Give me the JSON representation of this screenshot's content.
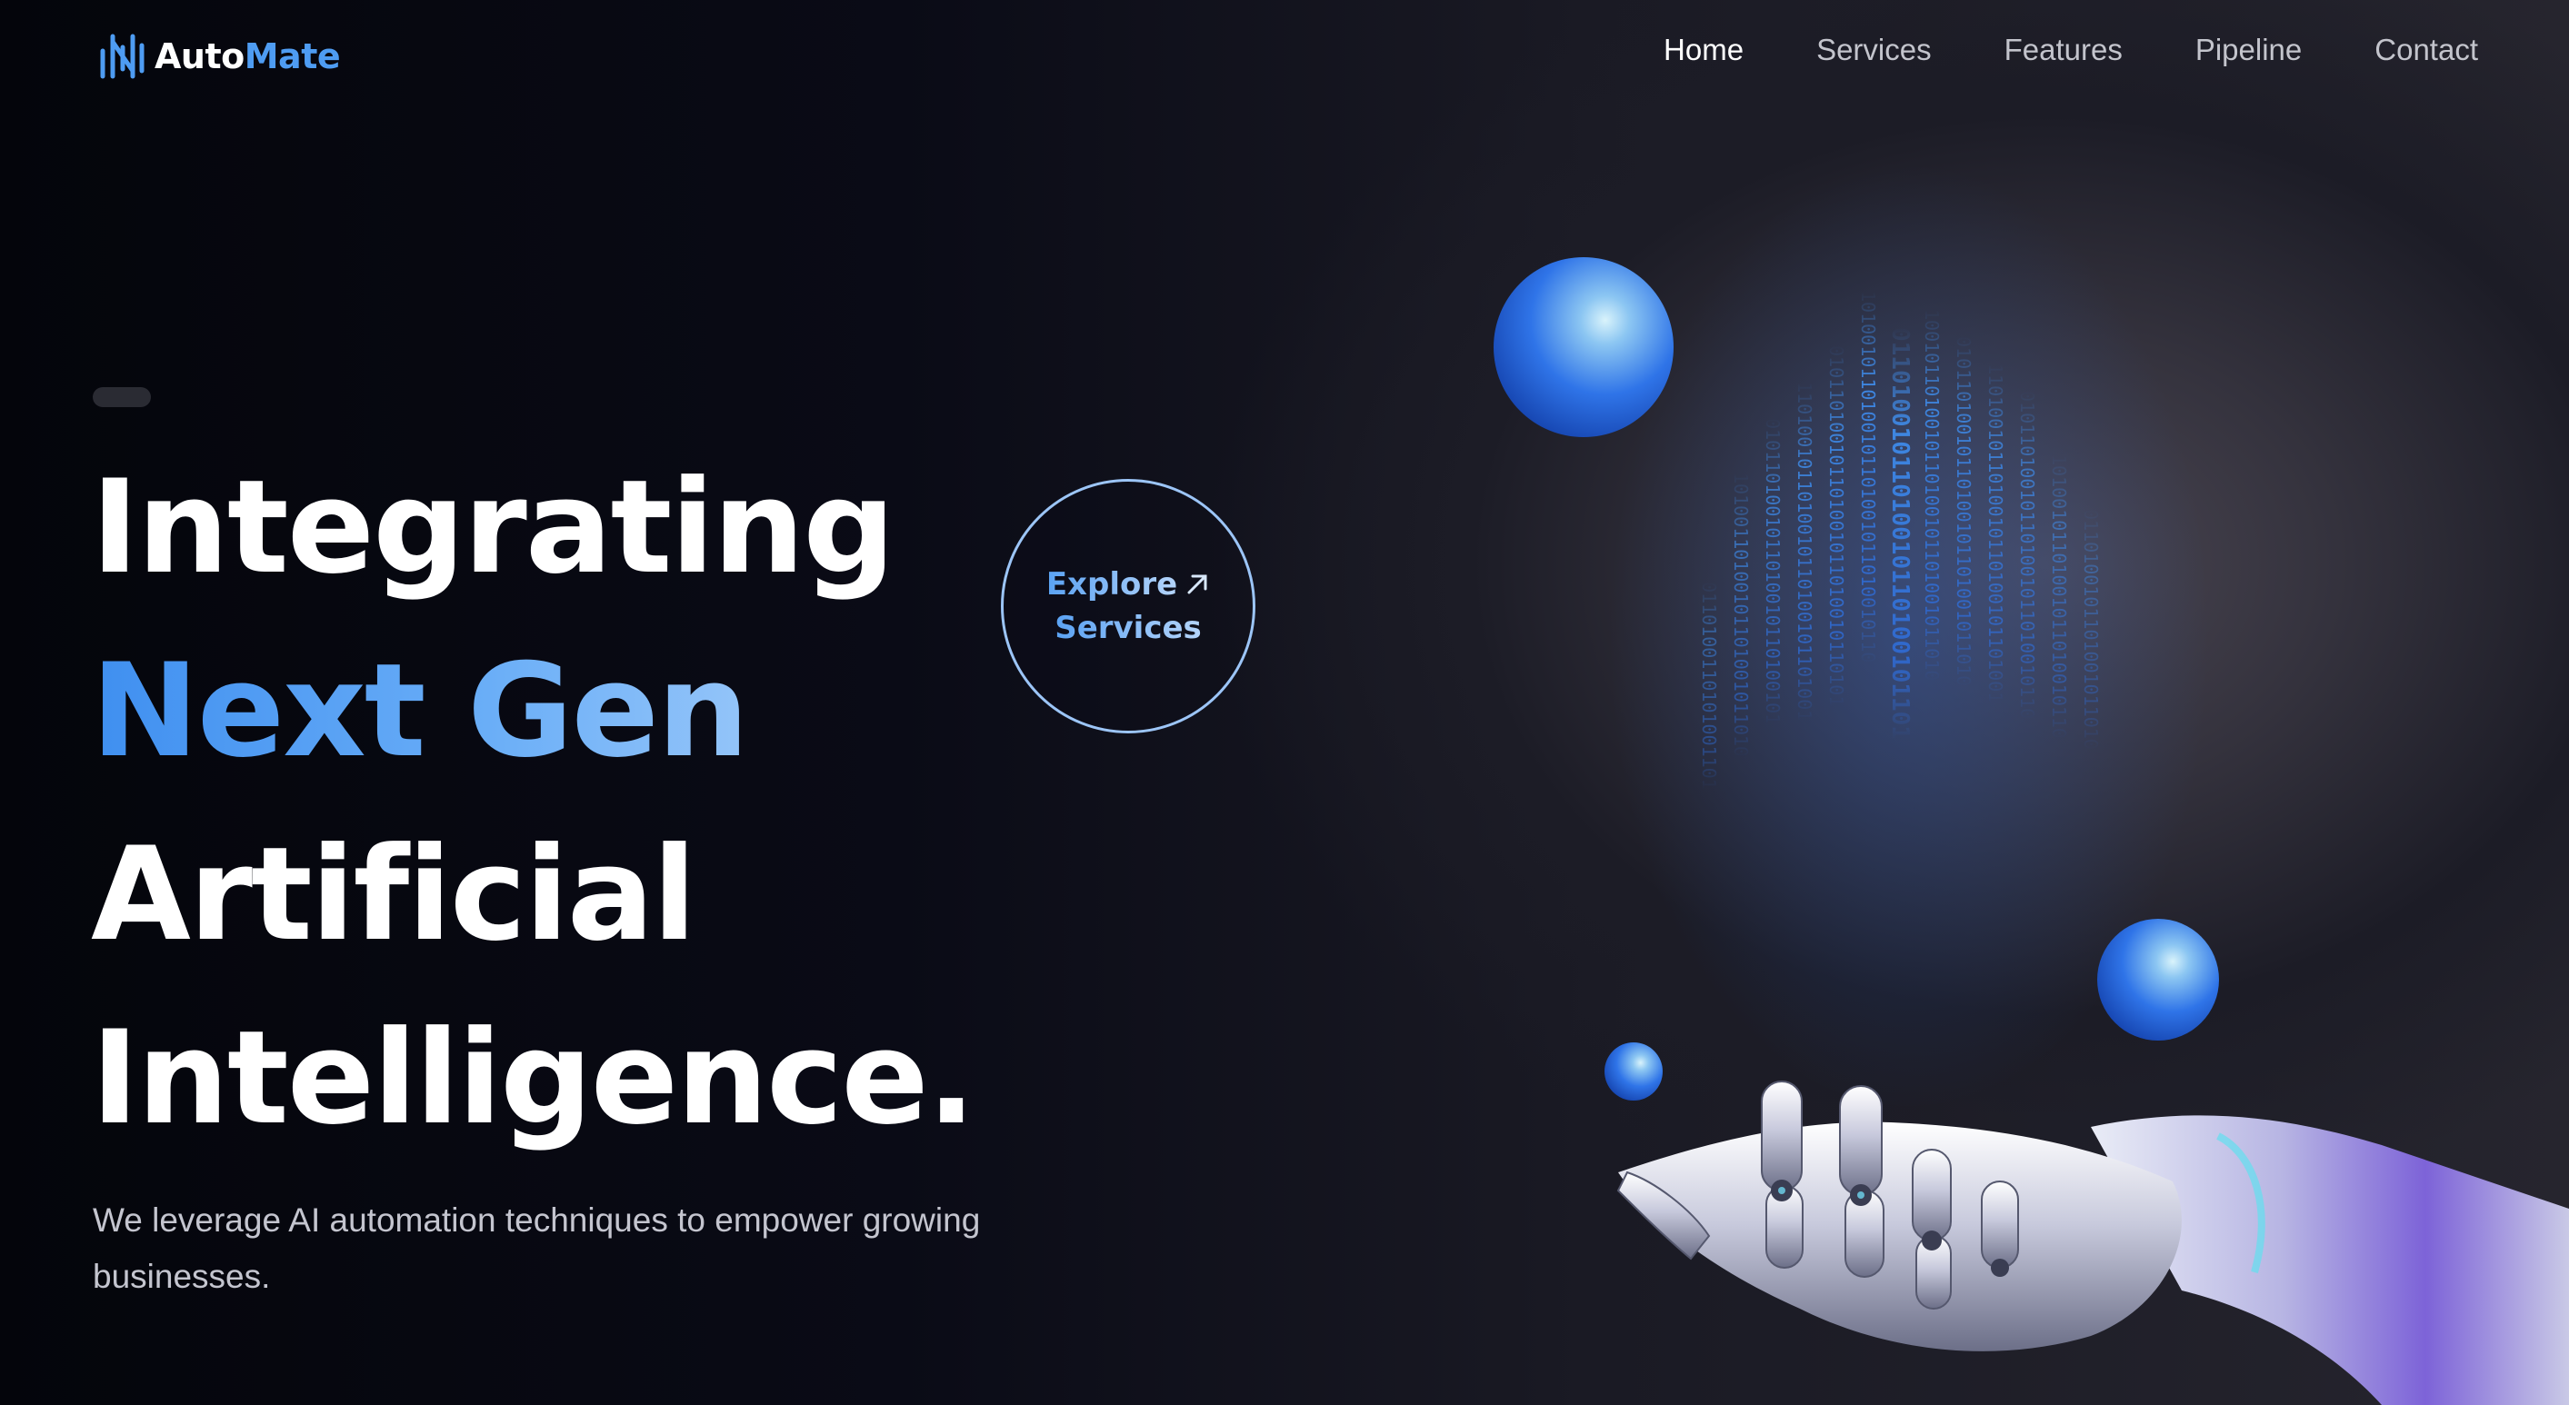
{
  "brand": {
    "name_part1": "Auto",
    "name_part2": "Mate"
  },
  "nav": {
    "items": [
      {
        "label": "Home",
        "active": true
      },
      {
        "label": "Services",
        "active": false
      },
      {
        "label": "Features",
        "active": false
      },
      {
        "label": "Pipeline",
        "active": false
      },
      {
        "label": "Contact",
        "active": false
      }
    ]
  },
  "hero": {
    "line1": "Integrating",
    "line2": "Next Gen",
    "line3": "Artificial",
    "line4": "Intelligence.",
    "subtitle": "We leverage AI automation techniques to empower growing businesses."
  },
  "cta": {
    "line1": "Explore",
    "line2": "Services"
  },
  "colors": {
    "accent": "#4e9cf2",
    "accent_light": "#b8d8fb",
    "background": "#05060c",
    "nav_text": "#c3c4cc"
  },
  "icons": {
    "logo": "waveform-icon",
    "cta": "arrow-up-right-icon"
  }
}
